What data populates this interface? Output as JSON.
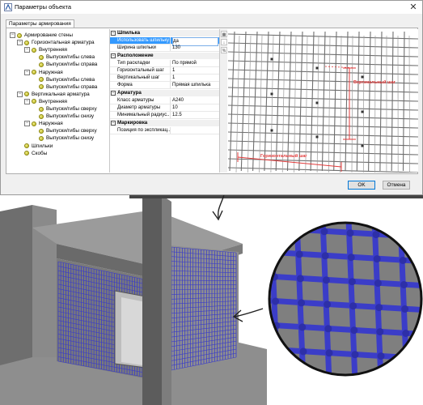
{
  "window": {
    "title": "Параметры объекта",
    "close_glyph": "✕"
  },
  "tab": {
    "label": "Параметры армирования"
  },
  "tree": [
    {
      "label": "Армирование стены",
      "toggle": "−",
      "indent": 0
    },
    {
      "label": "Горизонтальная арматура",
      "toggle": "−",
      "indent": 1
    },
    {
      "label": "Внутренняя",
      "toggle": "−",
      "indent": 2
    },
    {
      "label": "Выпуски/гибы слева",
      "toggle": "",
      "indent": 3
    },
    {
      "label": "Выпуски/гибы справа",
      "toggle": "",
      "indent": 3
    },
    {
      "label": "Наружная",
      "toggle": "−",
      "indent": 2
    },
    {
      "label": "Выпуски/гибы слева",
      "toggle": "",
      "indent": 3
    },
    {
      "label": "Выпуски/гибы справа",
      "toggle": "",
      "indent": 3
    },
    {
      "label": "Вертикальная арматура",
      "toggle": "−",
      "indent": 1
    },
    {
      "label": "Внутренняя",
      "toggle": "−",
      "indent": 2
    },
    {
      "label": "Выпуски/гибы сверху",
      "toggle": "",
      "indent": 3
    },
    {
      "label": "Выпуски/гибы снизу",
      "toggle": "",
      "indent": 3
    },
    {
      "label": "Наружная",
      "toggle": "−",
      "indent": 2
    },
    {
      "label": "Выпуски/гибы сверху",
      "toggle": "",
      "indent": 3
    },
    {
      "label": "Выпуски/гибы снизу",
      "toggle": "",
      "indent": 3
    },
    {
      "label": "Шпильки",
      "toggle": "",
      "indent": 1
    },
    {
      "label": "Скобы",
      "toggle": "",
      "indent": 1
    }
  ],
  "properties": {
    "cat_spike": "Шпилька",
    "use_spike": {
      "name": "Использовать шпильку",
      "value": "да"
    },
    "spike_width": {
      "name": "Ширина шпильки",
      "value": "130"
    },
    "cat_layout": "Расположение",
    "layout_type": {
      "name": "Тип раскладки",
      "value": "По прямой"
    },
    "h_step": {
      "name": "Горизонтальный шаг",
      "value": "1"
    },
    "v_step": {
      "name": "Вертикальный шаг",
      "value": "1"
    },
    "shape": {
      "name": "Форма",
      "value": "Прямая шпилька"
    },
    "cat_rebar": "Арматура",
    "rebar_class": {
      "name": "Класс арматуры",
      "value": "A240"
    },
    "rebar_diameter": {
      "name": "Диаметр арматуры",
      "value": "10"
    },
    "min_radius": {
      "name": "Минимальный радиус...",
      "value": "12.5"
    },
    "cat_marking": "Маркировка",
    "spec_position": {
      "name": "Позиция по экспликац...",
      "value": ""
    }
  },
  "toolbar_icons": [
    "sort-categorized-icon",
    "sort-alpha-icon",
    "properties-icon"
  ],
  "preview": {
    "vertical_step_label": "Вертикальный шаг",
    "horizontal_step_label": "Горизонтальный шаг"
  },
  "buttons": {
    "ok": "OK",
    "cancel": "Отмена"
  },
  "colors": {
    "selection": "#3399ff",
    "dimension": "#e23b3b",
    "rebar": "#3b3dc8"
  }
}
